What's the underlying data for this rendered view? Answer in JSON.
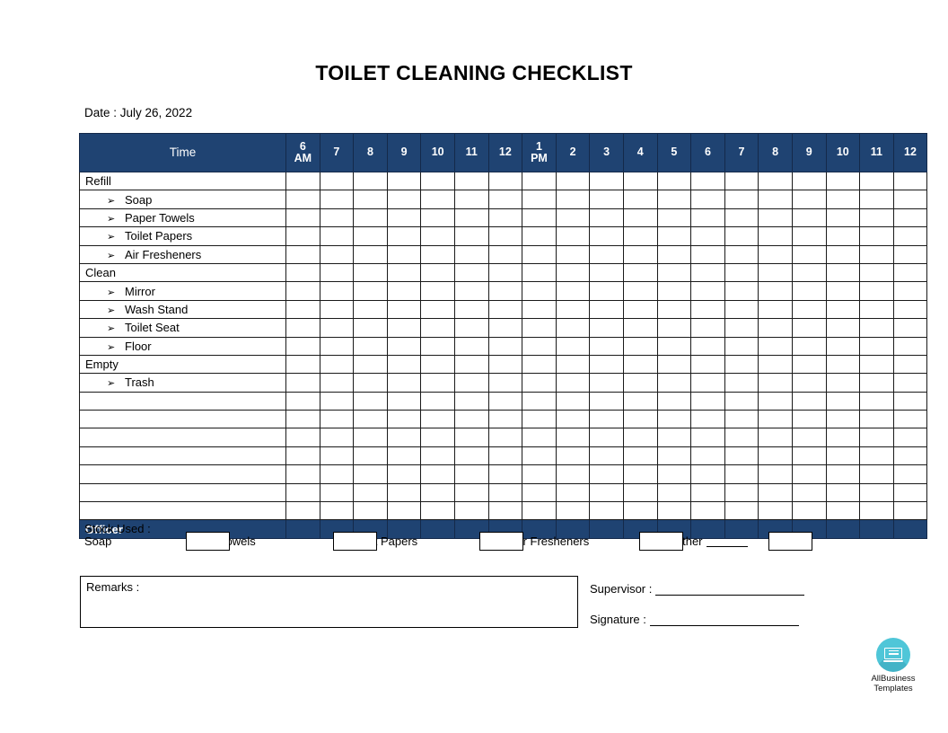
{
  "document": {
    "title": "TOILET CLEANING CHECKLIST",
    "date_label": "Date : July 26, 2022"
  },
  "table": {
    "time_header": "Time",
    "hour_columns": [
      "6\nAM",
      "7",
      "8",
      "9",
      "10",
      "11",
      "12",
      "1\nPM",
      "2",
      "3",
      "4",
      "5",
      "6",
      "7",
      "8",
      "9",
      "10",
      "11",
      "12"
    ],
    "rows": [
      {
        "label": "Refill",
        "type": "group"
      },
      {
        "label": "Soap",
        "type": "item"
      },
      {
        "label": "Paper Towels",
        "type": "item"
      },
      {
        "label": "Toilet Papers",
        "type": "item"
      },
      {
        "label": "Air Fresheners",
        "type": "item"
      },
      {
        "label": "Clean",
        "type": "group"
      },
      {
        "label": "Mirror",
        "type": "item"
      },
      {
        "label": "Wash Stand",
        "type": "item"
      },
      {
        "label": "Toilet Seat",
        "type": "item"
      },
      {
        "label": "Floor",
        "type": "item"
      },
      {
        "label": "Empty",
        "type": "group"
      },
      {
        "label": "Trash",
        "type": "item"
      },
      {
        "label": "",
        "type": "blank"
      },
      {
        "label": "",
        "type": "blank"
      },
      {
        "label": "",
        "type": "blank"
      },
      {
        "label": "",
        "type": "blank"
      },
      {
        "label": "",
        "type": "blank"
      },
      {
        "label": "",
        "type": "blank"
      },
      {
        "label": "",
        "type": "blank"
      }
    ],
    "officer_label": "Officer",
    "bullet_glyph": "➢",
    "header_color": "#1F4372"
  },
  "stock": {
    "heading": "Stock Used :",
    "items": [
      {
        "label": "Soap"
      },
      {
        "label": "Paper Towels"
      },
      {
        "label": "Toilet Papers"
      },
      {
        "label": "Air Fresheners"
      },
      {
        "label": "Other"
      }
    ]
  },
  "remarks": {
    "label": "Remarks :",
    "value": ""
  },
  "signature": {
    "supervisor_label": "Supervisor :",
    "supervisor_value": "",
    "signature_label": "Signature :",
    "signature_value": ""
  },
  "logo": {
    "line1": "AllBusiness",
    "line2": "Templates",
    "color": "#4FC6D8"
  }
}
